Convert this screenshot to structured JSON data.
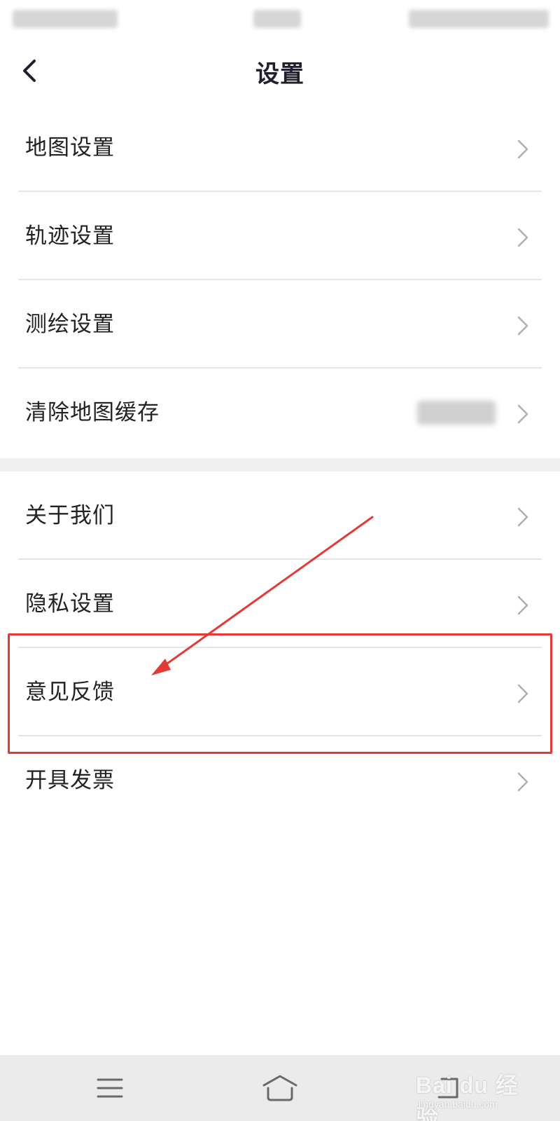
{
  "header": {
    "title": "设置"
  },
  "groups": [
    {
      "items": [
        {
          "label": "地图设置"
        },
        {
          "label": "轨迹设置"
        },
        {
          "label": "测绘设置"
        },
        {
          "label": "清除地图缓存"
        }
      ]
    },
    {
      "items": [
        {
          "label": "关于我们"
        },
        {
          "label": "隐私设置"
        },
        {
          "label": "意见反馈"
        },
        {
          "label": "开具发票"
        }
      ]
    }
  ],
  "annotation": {
    "highlight_color": "#e53935",
    "highlighted_item": "意见反馈"
  },
  "watermark": {
    "brand": "Bai du 经验",
    "url": "jingyan.baidu.com"
  },
  "icons": {
    "back": "chevron-left-icon",
    "row_arrow": "chevron-right-icon",
    "nav_menu": "menu-icon",
    "nav_home": "home-icon",
    "nav_back": "back-icon"
  },
  "colors": {
    "title": "#1f1f2e",
    "text": "#222222",
    "divider": "#e6e6e6",
    "group_separator": "#f0f0f0",
    "nav_bar": "#ebebeb"
  }
}
